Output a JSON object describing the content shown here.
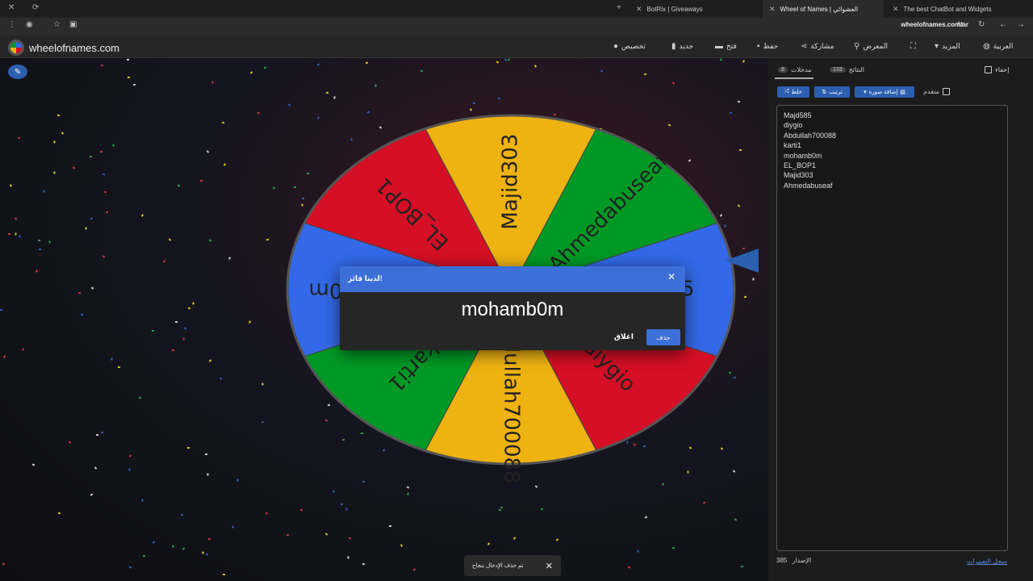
{
  "browser": {
    "tabs": [
      {
        "title": "BotRix | Giveaways",
        "active": false
      },
      {
        "title": "Wheel of Names | العشوائي",
        "active": true
      },
      {
        "title": "The best ChatBot and Widgets",
        "active": false
      }
    ],
    "url": "wheelofnames.com/ar"
  },
  "header": {
    "logo_text": "wheelofnames.com",
    "nav": {
      "customize": "تخصيص",
      "new": "جديد",
      "open": "فتح",
      "save": "حفظ",
      "share": "مشاركة",
      "gallery": "المعرض",
      "more": "المزيد",
      "language": "العربية"
    }
  },
  "wheel": {
    "colors": {
      "blue": "#3369e8",
      "red": "#d50f25",
      "yellow": "#eeb211",
      "green": "#009925"
    },
    "segments": [
      {
        "label": "Majd585",
        "color": "#3369e8"
      },
      {
        "label": "diygio",
        "color": "#d50f25"
      },
      {
        "label": "Abdullah700088",
        "color": "#eeb211"
      },
      {
        "label": "karti1",
        "color": "#009925"
      },
      {
        "label": "mohamb0m",
        "color": "#3369e8"
      },
      {
        "label": "EL_BOP1",
        "color": "#d50f25"
      },
      {
        "label": "Majid303",
        "color": "#eeb211"
      },
      {
        "label": "Ahmedabuseaf",
        "color": "#009925"
      }
    ]
  },
  "sidebar": {
    "hide_label": "إخفاء",
    "tabs": {
      "entries_label": "مدخلات",
      "entries_count": "8",
      "results_label": "النتائج",
      "results_count": "133"
    },
    "buttons": {
      "shuffle": "خلط",
      "sort": "ترتيب",
      "add_image": "إضافة صورة",
      "advanced": "متقدم"
    },
    "entries": [
      "Majd585",
      "diygio",
      "Abdullah700088",
      "karti1",
      "mohamb0m",
      "EL_BOP1",
      "Majid303",
      "Ahmedabuseaf"
    ],
    "version_label": "الإصدار",
    "version_number": "385",
    "changelog": "سجل التغييرات"
  },
  "modal": {
    "title": "لدينا فائز!",
    "winner": "mohamb0m",
    "remove_label": "حذف",
    "close_label": "اغلاق"
  },
  "toast": {
    "message": "تم حذف الإدخال بنجاح"
  }
}
